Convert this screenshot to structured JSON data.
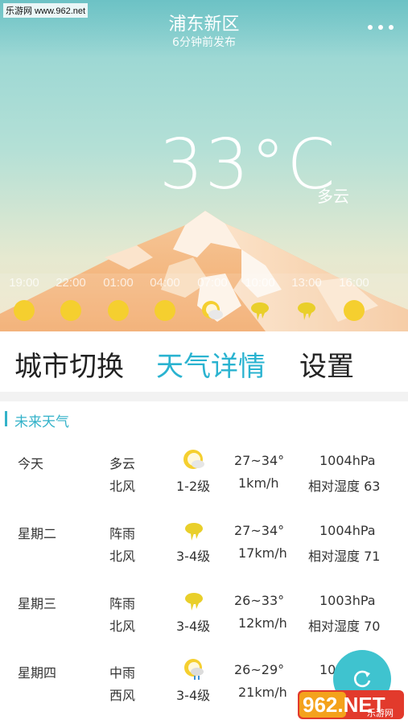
{
  "watermark": "乐游网 www.962.net",
  "header": {
    "city": "浦东新区",
    "published": "6分钟前发布"
  },
  "current": {
    "temperature": "33°C",
    "condition": "多云"
  },
  "hourly": [
    {
      "time": "19:00",
      "icon": "sun-icon"
    },
    {
      "time": "22:00",
      "icon": "sun-icon"
    },
    {
      "time": "01:00",
      "icon": "sun-icon"
    },
    {
      "time": "04:00",
      "icon": "sun-icon"
    },
    {
      "time": "07:00",
      "icon": "partly-cloudy-icon"
    },
    {
      "time": "10:00",
      "icon": "shower-icon"
    },
    {
      "time": "13:00",
      "icon": "shower-icon"
    },
    {
      "time": "16:00",
      "icon": "sun-icon"
    }
  ],
  "tabs": [
    {
      "label": "城市切换",
      "active": false
    },
    {
      "label": "天气详情",
      "active": true
    },
    {
      "label": "设置",
      "active": false
    }
  ],
  "forecast": {
    "title": "未来天气",
    "days": [
      {
        "day": "今天",
        "condition": "多云",
        "wind_dir": "北风",
        "wind_level": "1-2级",
        "temp": "27~34°",
        "speed": "1km/h",
        "pressure": "1004hPa",
        "humidity": "相对湿度 63",
        "icon": "partly-cloudy-icon"
      },
      {
        "day": "星期二",
        "condition": "阵雨",
        "wind_dir": "北风",
        "wind_level": "3-4级",
        "temp": "27~34°",
        "speed": "17km/h",
        "pressure": "1004hPa",
        "humidity": "相对湿度 71",
        "icon": "shower-icon"
      },
      {
        "day": "星期三",
        "condition": "阵雨",
        "wind_dir": "北风",
        "wind_level": "3-4级",
        "temp": "26~33°",
        "speed": "12km/h",
        "pressure": "1003hPa",
        "humidity": "相对湿度 70",
        "icon": "shower-icon"
      },
      {
        "day": "星期四",
        "condition": "中雨",
        "wind_dir": "西风",
        "wind_level": "3-4级",
        "temp": "26~29°",
        "speed": "21km/h",
        "pressure": "10",
        "humidity": "",
        "icon": "rain-icon"
      }
    ]
  },
  "logo": {
    "text": "962.NET",
    "sub": "乐游网"
  },
  "colors": {
    "accent": "#2ab3d0",
    "sun": "#f5cf2f",
    "fab": "#3fc3cf"
  }
}
